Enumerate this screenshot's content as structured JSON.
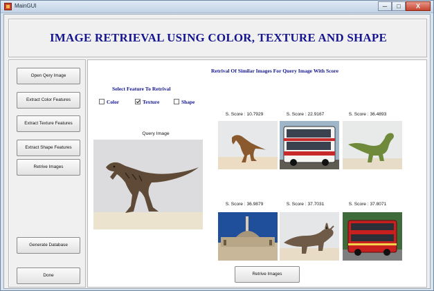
{
  "window": {
    "title": "MainGUI",
    "controls": {
      "minimize": "─",
      "maximize": "□",
      "close": "X"
    }
  },
  "header": {
    "title": "IMAGE RETRIEVAL USING COLOR, TEXTURE AND SHAPE"
  },
  "sidebar": {
    "buttons": [
      {
        "label": "Open Qery Image"
      },
      {
        "label": "Extract Color Features"
      },
      {
        "label": "Extract Texture Features"
      },
      {
        "label": "Extract Shape Features"
      },
      {
        "label": "Retrive Images"
      },
      {
        "label": "Generate Database"
      },
      {
        "label": "Done"
      }
    ]
  },
  "main": {
    "results_heading": "Retrival Of Similar Images For Query Image With Score",
    "feature_heading": "Select Feature To Retrival",
    "features": [
      {
        "label": "Color",
        "checked": false
      },
      {
        "label": "Texture",
        "checked": true
      },
      {
        "label": "Shape",
        "checked": false
      }
    ],
    "query_label": "Query Image",
    "query_image": "dinosaur-icon",
    "results": [
      {
        "score_label": "S. Score : 10.7929",
        "image": "dinosaur-icon"
      },
      {
        "score_label": "S. Score : 22.9167",
        "image": "bus-icon"
      },
      {
        "score_label": "S. Score : 36.4893",
        "image": "dinosaur-icon"
      },
      {
        "score_label": "S. Score : 36.9879",
        "image": "building-icon"
      },
      {
        "score_label": "S. Score : 37.7031",
        "image": "dinosaur-icon"
      },
      {
        "score_label": "S. Score : 37.8071",
        "image": "bus-icon"
      }
    ],
    "retrieve_button": "Retrive Images"
  },
  "colors": {
    "heading": "#15158f",
    "panel_bg": "#f0f0f0",
    "results_bg": "#ffffff",
    "close_button": "#c4442d"
  }
}
